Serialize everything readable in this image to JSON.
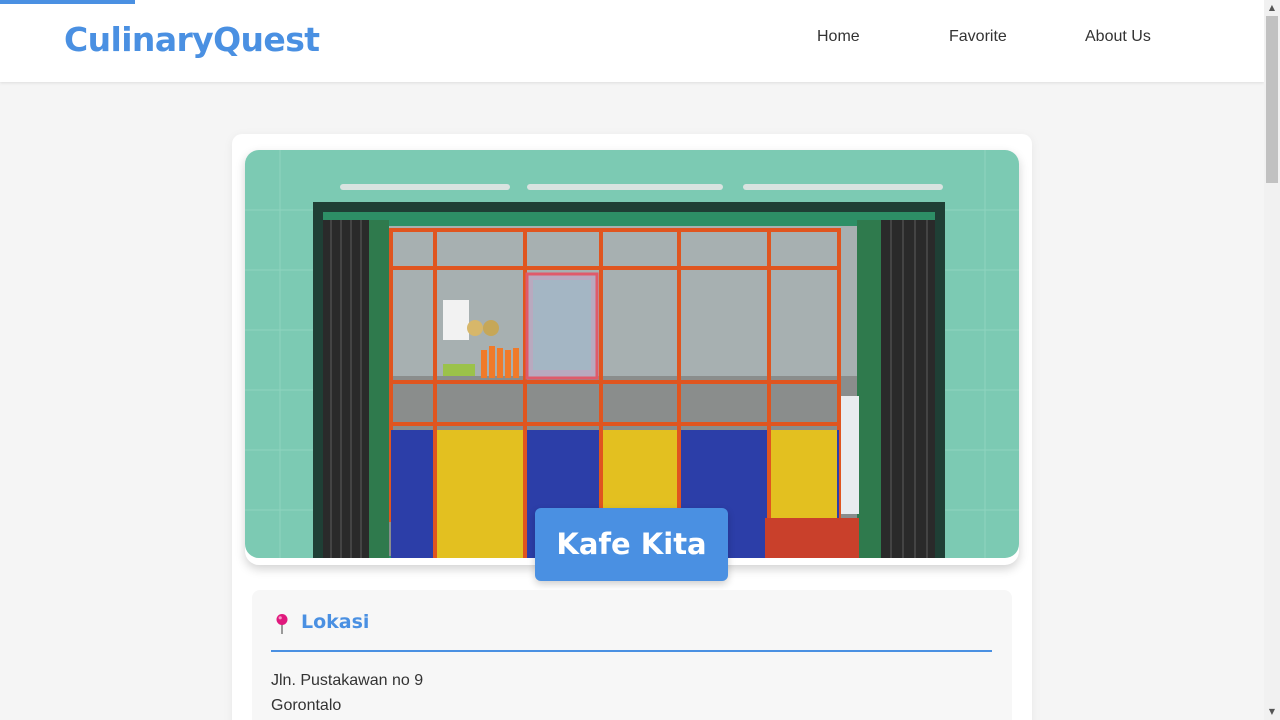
{
  "app": {
    "brand": "CulinaryQuest"
  },
  "nav": {
    "home": "Home",
    "favorite": "Favorite",
    "about": "About Us"
  },
  "restaurant": {
    "name": "Kafe Kita",
    "image_alt": "Kafe Kita",
    "location_heading": "Lokasi",
    "address_line1": "Jln. Pustakawan no 9",
    "address_line2": "Gorontalo"
  },
  "colors": {
    "accent": "#4a90e2",
    "pin": "#e0197d",
    "background": "#f5f5f5",
    "wall": "#7fcab4"
  },
  "icons": {
    "location": "map-pin-icon"
  }
}
